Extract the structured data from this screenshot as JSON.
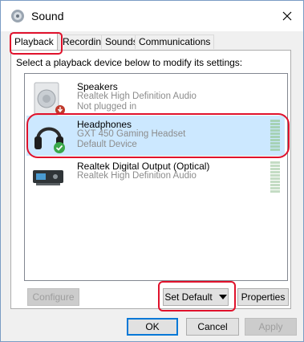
{
  "window": {
    "title": "Sound",
    "title_icon": "speaker-icon",
    "close_icon": "close-icon"
  },
  "tabs": [
    {
      "label": "Playback",
      "active": true
    },
    {
      "label": "Recording",
      "active": false
    },
    {
      "label": "Sounds",
      "active": false
    },
    {
      "label": "Communications",
      "active": false
    }
  ],
  "instruction": "Select a playback device below to modify its settings:",
  "devices": [
    {
      "name": "Speakers",
      "driver": "Realtek High Definition Audio",
      "status": "Not plugged in",
      "icon": "speaker-icon",
      "badge": "not-plugged-icon",
      "selected": false
    },
    {
      "name": "Headphones",
      "driver": "GXT 450 Gaming Headset",
      "status": "Default Device",
      "icon": "headphones-icon",
      "badge": "default-check-icon",
      "selected": true
    },
    {
      "name": "Realtek Digital Output (Optical)",
      "driver": "Realtek High Definition Audio",
      "status": "",
      "icon": "optical-output-icon",
      "badge": "",
      "selected": false
    }
  ],
  "buttons": {
    "configure": "Configure",
    "set_default": "Set Default",
    "properties": "Properties",
    "ok": "OK",
    "cancel": "Cancel",
    "apply": "Apply"
  },
  "colors": {
    "selection": "#cce8ff",
    "highlight": "#e0122c",
    "accent": "#0078d7"
  }
}
